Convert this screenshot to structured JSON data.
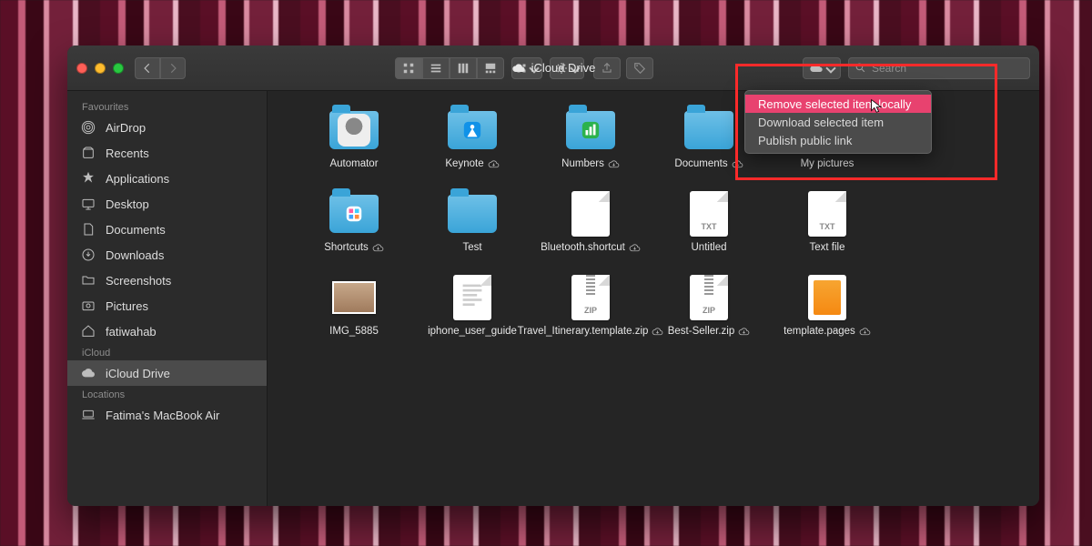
{
  "window": {
    "title": "iCloud Drive"
  },
  "search": {
    "placeholder": "Search"
  },
  "sidebar": {
    "sections": {
      "favourites": "Favourites",
      "icloud": "iCloud",
      "locations": "Locations"
    },
    "items": [
      {
        "label": "AirDrop"
      },
      {
        "label": "Recents"
      },
      {
        "label": "Applications"
      },
      {
        "label": "Desktop"
      },
      {
        "label": "Documents"
      },
      {
        "label": "Downloads"
      },
      {
        "label": "Screenshots"
      },
      {
        "label": "Pictures"
      },
      {
        "label": "fatiwahab"
      },
      {
        "label": "iCloud Drive"
      },
      {
        "label": "Fatima's MacBook Air"
      }
    ]
  },
  "menu": {
    "items": [
      {
        "label": "Remove selected item locally"
      },
      {
        "label": "Download selected item"
      },
      {
        "label": "Publish public link"
      }
    ]
  },
  "files": [
    {
      "name": "Automator",
      "cloud": false
    },
    {
      "name": "Keynote",
      "cloud": true
    },
    {
      "name": "Numbers",
      "cloud": true
    },
    {
      "name": "Documents",
      "cloud": true
    },
    {
      "name": "My pictures",
      "cloud": false
    },
    {
      "name": "Shortcuts",
      "cloud": true
    },
    {
      "name": "Test",
      "cloud": false
    },
    {
      "name": "Bluetooth.shortcut",
      "cloud": true
    },
    {
      "name": "Untitled",
      "cloud": false
    },
    {
      "name": "Text file",
      "cloud": false
    },
    {
      "name": "IMG_5885",
      "cloud": false
    },
    {
      "name": "iphone_user_guide",
      "cloud": false
    },
    {
      "name": "Travel_Itinerary.template.zip",
      "cloud": true
    },
    {
      "name": "Best-Seller.zip",
      "cloud": true
    },
    {
      "name": "template.pages",
      "cloud": true
    }
  ],
  "toolbar": {
    "icons": {
      "cloud": "cloud-icon",
      "search": "search-icon"
    }
  }
}
